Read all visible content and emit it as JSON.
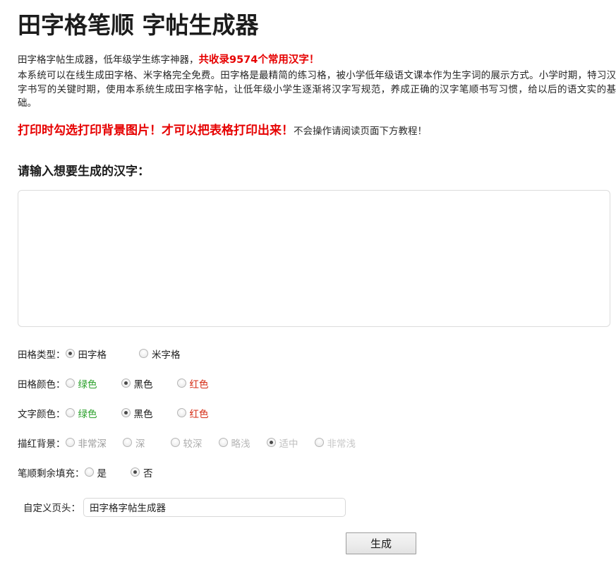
{
  "page": {
    "title": "田字格笔顺 字帖生成器"
  },
  "intro": {
    "line1_black": "田字格字帖生成器，低年级学生练字神器，",
    "line1_red": "共收录9574个常用汉字！",
    "body": "本系统可以在线生成田字格、米字格完全免费。田字格是最精简的练习格，被小学低年级语文课本作为生字词的展示方式。小学时期，特习汉字书写的关键时期，使用本系统生成田字格字帖，让低年级小学生逐渐将汉字写规范，养成正确的汉字笔顺书写习惯，给以后的语文实的基础。",
    "warn_red": "打印时勾选打印背景图片！才可以把表格打印出来！",
    "warn_black": "不会操作请阅读页面下方教程！"
  },
  "form": {
    "prompt": "请输入想要生成的汉字：",
    "textarea_value": "",
    "textarea_placeholder": "",
    "rows": [
      {
        "label": "田格类型：",
        "options": [
          {
            "text": "田字格",
            "checked": true,
            "class": "",
            "gap": 46
          },
          {
            "text": "米字格",
            "checked": false,
            "class": "",
            "gap": 0
          }
        ]
      },
      {
        "label": "田格颜色：",
        "options": [
          {
            "text": "绿色",
            "checked": false,
            "class": "c-green",
            "gap": 34
          },
          {
            "text": "黑色",
            "checked": true,
            "class": "c-black",
            "gap": 34
          },
          {
            "text": "红色",
            "checked": false,
            "class": "c-red",
            "gap": 0
          }
        ]
      },
      {
        "label": "文字颜色：",
        "options": [
          {
            "text": "绿色",
            "checked": false,
            "class": "c-green",
            "gap": 34
          },
          {
            "text": "黑色",
            "checked": true,
            "class": "c-black",
            "gap": 34
          },
          {
            "text": "红色",
            "checked": false,
            "class": "c-red",
            "gap": 0
          }
        ]
      },
      {
        "label": "描红背景：",
        "options": [
          {
            "text": "非常深",
            "checked": false,
            "class": "s1",
            "gap": 23
          },
          {
            "text": "深",
            "checked": false,
            "class": "s2",
            "gap": 36
          },
          {
            "text": "较深",
            "checked": false,
            "class": "s3",
            "gap": 23
          },
          {
            "text": "略浅",
            "checked": false,
            "class": "s4",
            "gap": 23
          },
          {
            "text": "适中",
            "checked": true,
            "class": "s5",
            "gap": 23
          },
          {
            "text": "非常浅",
            "checked": false,
            "class": "s6",
            "gap": 0
          }
        ]
      },
      {
        "label": "笔顺剩余填充：",
        "options": [
          {
            "text": "是",
            "checked": false,
            "class": "",
            "gap": 34
          },
          {
            "text": "否",
            "checked": true,
            "class": "",
            "gap": 0
          }
        ]
      }
    ],
    "header_label": "自定义页头：",
    "header_value": "田字格字帖生成器",
    "header_placeholder": "",
    "submit_label": "生成"
  }
}
